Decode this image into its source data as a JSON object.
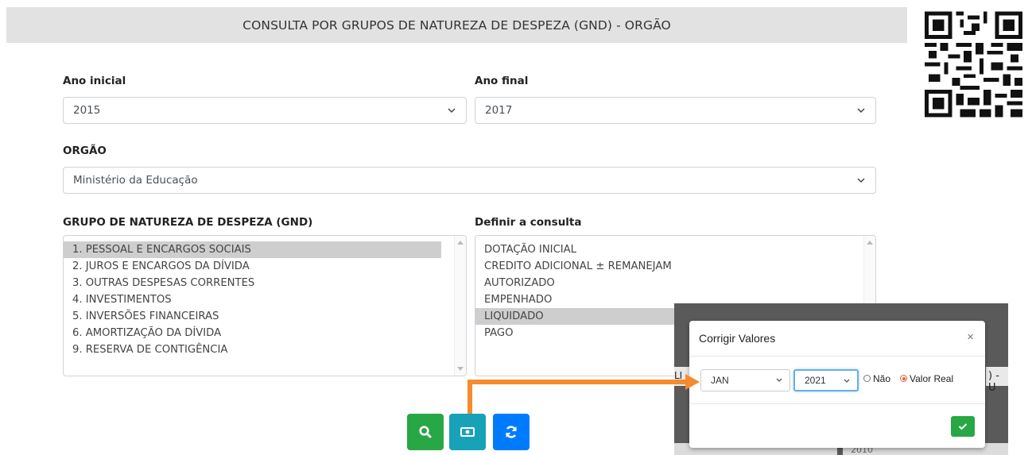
{
  "header": {
    "title": "CONSULTA POR GRUPOS DE NATUREZA DE DESPEZA (GND) - ORGÃO"
  },
  "form": {
    "ano_inicial": {
      "label": "Ano inicial",
      "value": "2015"
    },
    "ano_final": {
      "label": "Ano final",
      "value": "2017"
    },
    "orgao": {
      "label": "ORGÃO",
      "value": "Ministério da Educação"
    },
    "gnd": {
      "label": "GRUPO DE NATUREZA DE DESPEZA (GND)",
      "options": [
        "1. PESSOAL E ENCARGOS SOCIAIS",
        "2. JUROS E ENCARGOS DA DÍVIDA",
        "3. OUTRAS DESPESAS CORRENTES",
        "4. INVESTIMENTOS",
        "5. INVERSÕES FINANCEIRAS",
        "6. AMORTIZAÇÃO DA DÍVIDA",
        "9. RESERVA DE CONTIGÊNCIA"
      ],
      "selected_index": 0
    },
    "consulta": {
      "label": "Definir a consulta",
      "options": [
        "DOTAÇÃO INICIAL",
        "CREDITO ADICIONAL ± REMANEJAM",
        "AUTORIZADO",
        "EMPENHADO",
        "LIQUIDADO",
        "PAGO"
      ],
      "selected_index": 4
    }
  },
  "buttons": {
    "search": {
      "icon": "search-icon",
      "color": "#28a745"
    },
    "money": {
      "icon": "money-bill-icon",
      "color": "#17a2b8"
    },
    "refresh": {
      "icon": "refresh-icon",
      "color": "#007bff"
    }
  },
  "background_partial": {
    "right_text": ") - U",
    "left_text": "LI",
    "year": "2010"
  },
  "modal": {
    "title": "Corrigir Valores",
    "close": "×",
    "month": "JAN",
    "year": "2021",
    "radio_options": [
      "Não",
      "Valor Real"
    ],
    "selected_radio": "Valor Real"
  },
  "colors": {
    "arrow": "#f58a2f",
    "header_bg": "#e2e2e2",
    "selected_option": "#cecece"
  }
}
